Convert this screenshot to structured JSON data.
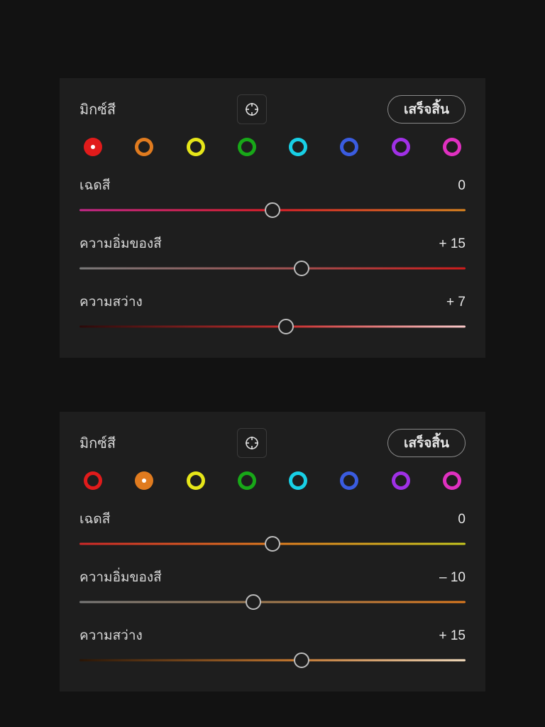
{
  "panels": [
    {
      "title": "มิกซ์สี",
      "done_label": "เสร็จสิ้น",
      "selected_color_index": 0,
      "colors": [
        {
          "name": "red",
          "hex": "#e11b1b"
        },
        {
          "name": "orange",
          "hex": "#e07b1f"
        },
        {
          "name": "yellow",
          "hex": "#e6e619"
        },
        {
          "name": "green",
          "hex": "#18a818"
        },
        {
          "name": "cyan",
          "hex": "#18d0e6"
        },
        {
          "name": "blue",
          "hex": "#3a5ce0"
        },
        {
          "name": "purple",
          "hex": "#a030e6"
        },
        {
          "name": "magenta",
          "hex": "#e030c0"
        }
      ],
      "sliders": [
        {
          "label": "เฉดสี",
          "value_text": "0",
          "value_num": 0,
          "track_class": "grad-r-hue"
        },
        {
          "label": "ความอิ่มของสี",
          "value_text": "+ 15",
          "value_num": 15,
          "track_class": "grad-r-sat"
        },
        {
          "label": "ความสว่าง",
          "value_text": "+ 7",
          "value_num": 7,
          "track_class": "grad-r-lum"
        }
      ]
    },
    {
      "title": "มิกซ์สี",
      "done_label": "เสร็จสิ้น",
      "selected_color_index": 1,
      "colors": [
        {
          "name": "red",
          "hex": "#e11b1b"
        },
        {
          "name": "orange",
          "hex": "#e07b1f"
        },
        {
          "name": "yellow",
          "hex": "#e6e619"
        },
        {
          "name": "green",
          "hex": "#18a818"
        },
        {
          "name": "cyan",
          "hex": "#18d0e6"
        },
        {
          "name": "blue",
          "hex": "#3a5ce0"
        },
        {
          "name": "purple",
          "hex": "#a030e6"
        },
        {
          "name": "magenta",
          "hex": "#e030c0"
        }
      ],
      "sliders": [
        {
          "label": "เฉดสี",
          "value_text": "0",
          "value_num": 0,
          "track_class": "grad-o-hue"
        },
        {
          "label": "ความอิ่มของสี",
          "value_text": "– 10",
          "value_num": -10,
          "track_class": "grad-o-sat"
        },
        {
          "label": "ความสว่าง",
          "value_text": "+ 15",
          "value_num": 15,
          "track_class": "grad-o-lum"
        }
      ]
    }
  ]
}
